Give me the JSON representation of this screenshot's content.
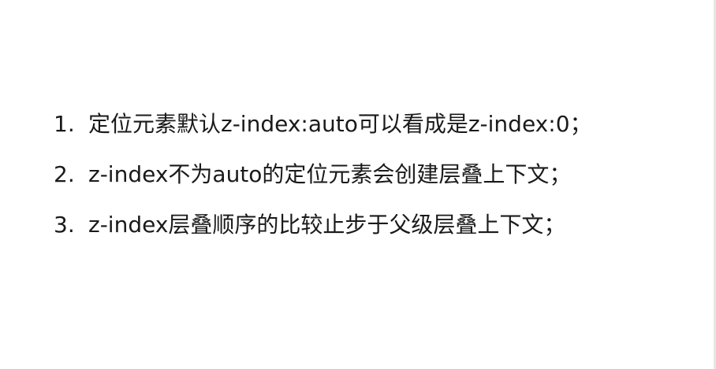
{
  "points": [
    {
      "num": "1.",
      "text": "定位元素默认z-index:auto可以看成是z-index:0；"
    },
    {
      "num": "2.",
      "text": "z-index不为auto的定位元素会创建层叠上下文；"
    },
    {
      "num": "3.",
      "text": "z-index层叠顺序的比较止步于父级层叠上下文；"
    }
  ]
}
